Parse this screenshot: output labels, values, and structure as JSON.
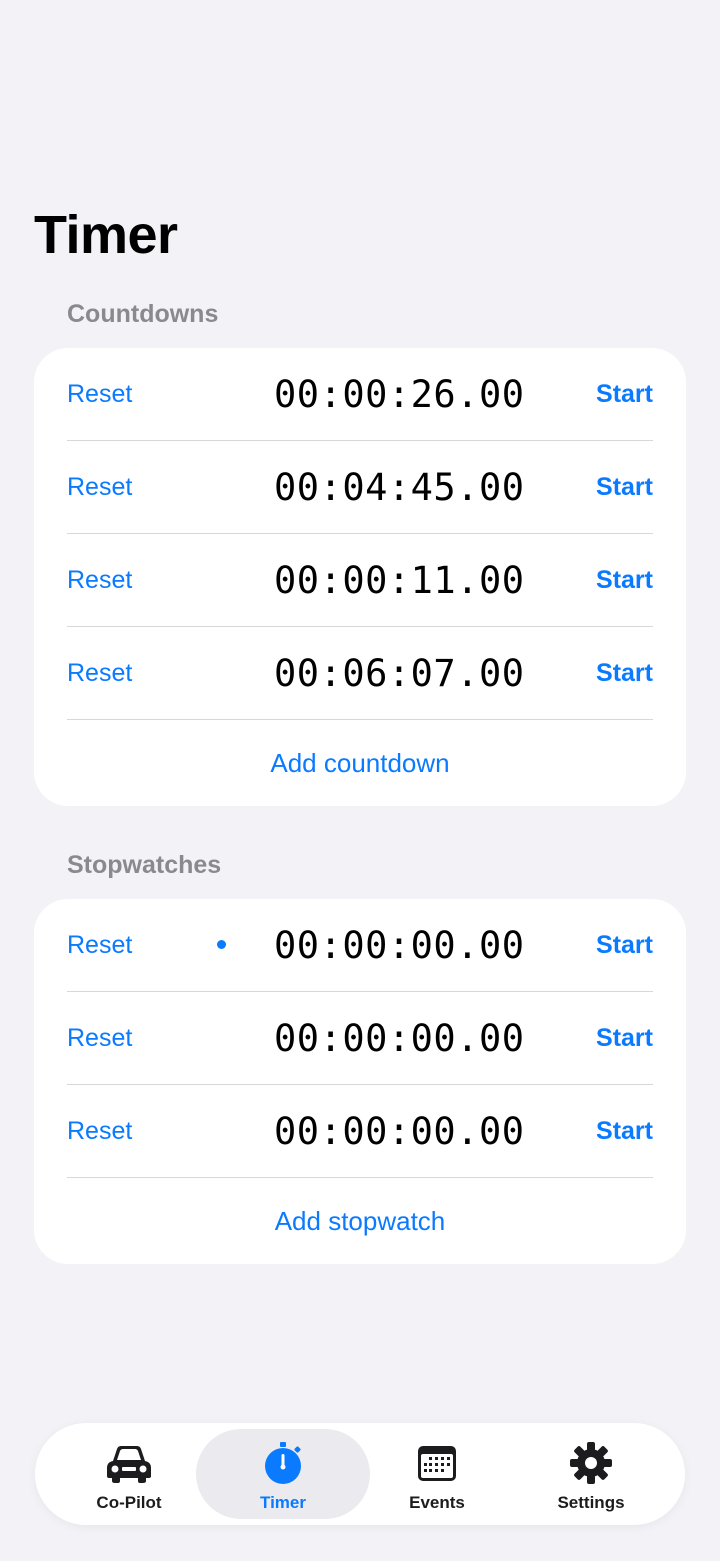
{
  "title": "Timer",
  "countdowns": {
    "header": "Countdowns",
    "rows": [
      {
        "reset": "Reset",
        "time": "00:00:26.00",
        "start": "Start"
      },
      {
        "reset": "Reset",
        "time": "00:04:45.00",
        "start": "Start"
      },
      {
        "reset": "Reset",
        "time": "00:00:11.00",
        "start": "Start"
      },
      {
        "reset": "Reset",
        "time": "00:06:07.00",
        "start": "Start"
      }
    ],
    "add_label": "Add countdown"
  },
  "stopwatches": {
    "header": "Stopwatches",
    "rows": [
      {
        "reset": "Reset",
        "time": "00:00:00.00",
        "start": "Start"
      },
      {
        "reset": "Reset",
        "time": "00:00:00.00",
        "start": "Start"
      },
      {
        "reset": "Reset",
        "time": "00:00:00.00",
        "start": "Start"
      }
    ],
    "add_label": "Add stopwatch"
  },
  "tabs": [
    {
      "label": "Co-Pilot",
      "icon": "car-icon"
    },
    {
      "label": "Timer",
      "icon": "stopwatch-icon",
      "active": true
    },
    {
      "label": "Events",
      "icon": "calendar-icon"
    },
    {
      "label": "Settings",
      "icon": "gear-icon"
    }
  ],
  "colors": {
    "accent": "#0a7aff",
    "background": "#f2f2f7",
    "section_header": "#8a8a8e"
  }
}
